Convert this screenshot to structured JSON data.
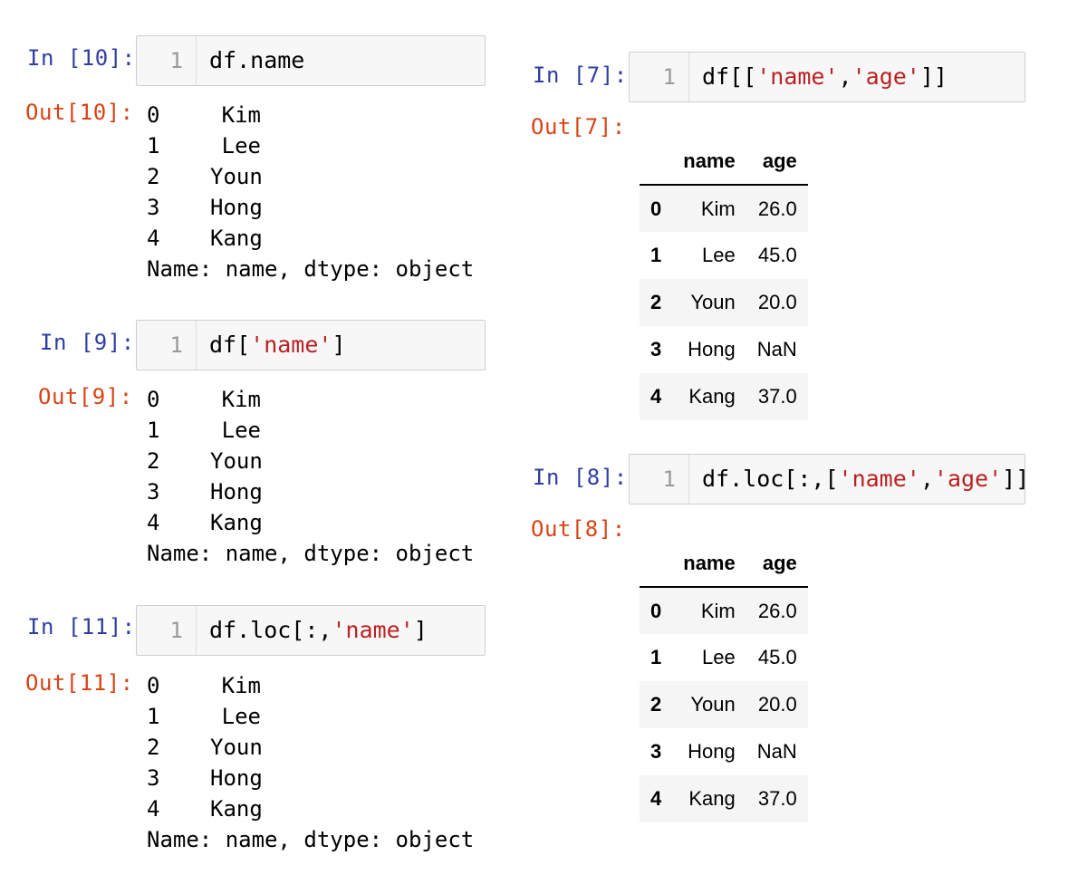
{
  "colors": {
    "in_prompt": "#303f9f",
    "out_prompt": "#d84315",
    "string": "#ba2121"
  },
  "cells": {
    "c10": {
      "in": "In [10]:",
      "out": "Out[10]:",
      "line": "1",
      "code_pre": "df.name",
      "code_str": "",
      "code_post": "",
      "rows": [
        {
          "i": "0",
          "v": "Kim"
        },
        {
          "i": "1",
          "v": "Lee"
        },
        {
          "i": "2",
          "v": "Youn"
        },
        {
          "i": "3",
          "v": "Hong"
        },
        {
          "i": "4",
          "v": "Kang"
        }
      ],
      "footer": "Name: name, dtype: object"
    },
    "c9": {
      "in": "In [9]:",
      "out": "Out[9]:",
      "line": "1",
      "code_pre": "df[",
      "code_str": "'name'",
      "code_post": "]",
      "rows": [
        {
          "i": "0",
          "v": "Kim"
        },
        {
          "i": "1",
          "v": "Lee"
        },
        {
          "i": "2",
          "v": "Youn"
        },
        {
          "i": "3",
          "v": "Hong"
        },
        {
          "i": "4",
          "v": "Kang"
        }
      ],
      "footer": "Name: name, dtype: object"
    },
    "c11": {
      "in": "In [11]:",
      "out": "Out[11]:",
      "line": "1",
      "code_pre": "df.loc[:,",
      "code_str": "'name'",
      "code_post": "]",
      "rows": [
        {
          "i": "0",
          "v": "Kim"
        },
        {
          "i": "1",
          "v": "Lee"
        },
        {
          "i": "2",
          "v": "Youn"
        },
        {
          "i": "3",
          "v": "Hong"
        },
        {
          "i": "4",
          "v": "Kang"
        }
      ],
      "footer": "Name: name, dtype: object"
    },
    "c7": {
      "in": "In [7]:",
      "out": "Out[7]:",
      "line": "1",
      "code_parts": [
        "df[[",
        "'name'",
        ",",
        "'age'",
        "]]"
      ],
      "headers": [
        "",
        "name",
        "age"
      ],
      "rows": [
        [
          "0",
          "Kim",
          "26.0"
        ],
        [
          "1",
          "Lee",
          "45.0"
        ],
        [
          "2",
          "Youn",
          "20.0"
        ],
        [
          "3",
          "Hong",
          "NaN"
        ],
        [
          "4",
          "Kang",
          "37.0"
        ]
      ]
    },
    "c8": {
      "in": "In [8]:",
      "out": "Out[8]:",
      "line": "1",
      "code_parts": [
        "df.loc[:,[",
        "'name'",
        ",",
        "'age'",
        "]]"
      ],
      "headers": [
        "",
        "name",
        "age"
      ],
      "rows": [
        [
          "0",
          "Kim",
          "26.0"
        ],
        [
          "1",
          "Lee",
          "45.0"
        ],
        [
          "2",
          "Youn",
          "20.0"
        ],
        [
          "3",
          "Hong",
          "NaN"
        ],
        [
          "4",
          "Kang",
          "37.0"
        ]
      ]
    }
  }
}
